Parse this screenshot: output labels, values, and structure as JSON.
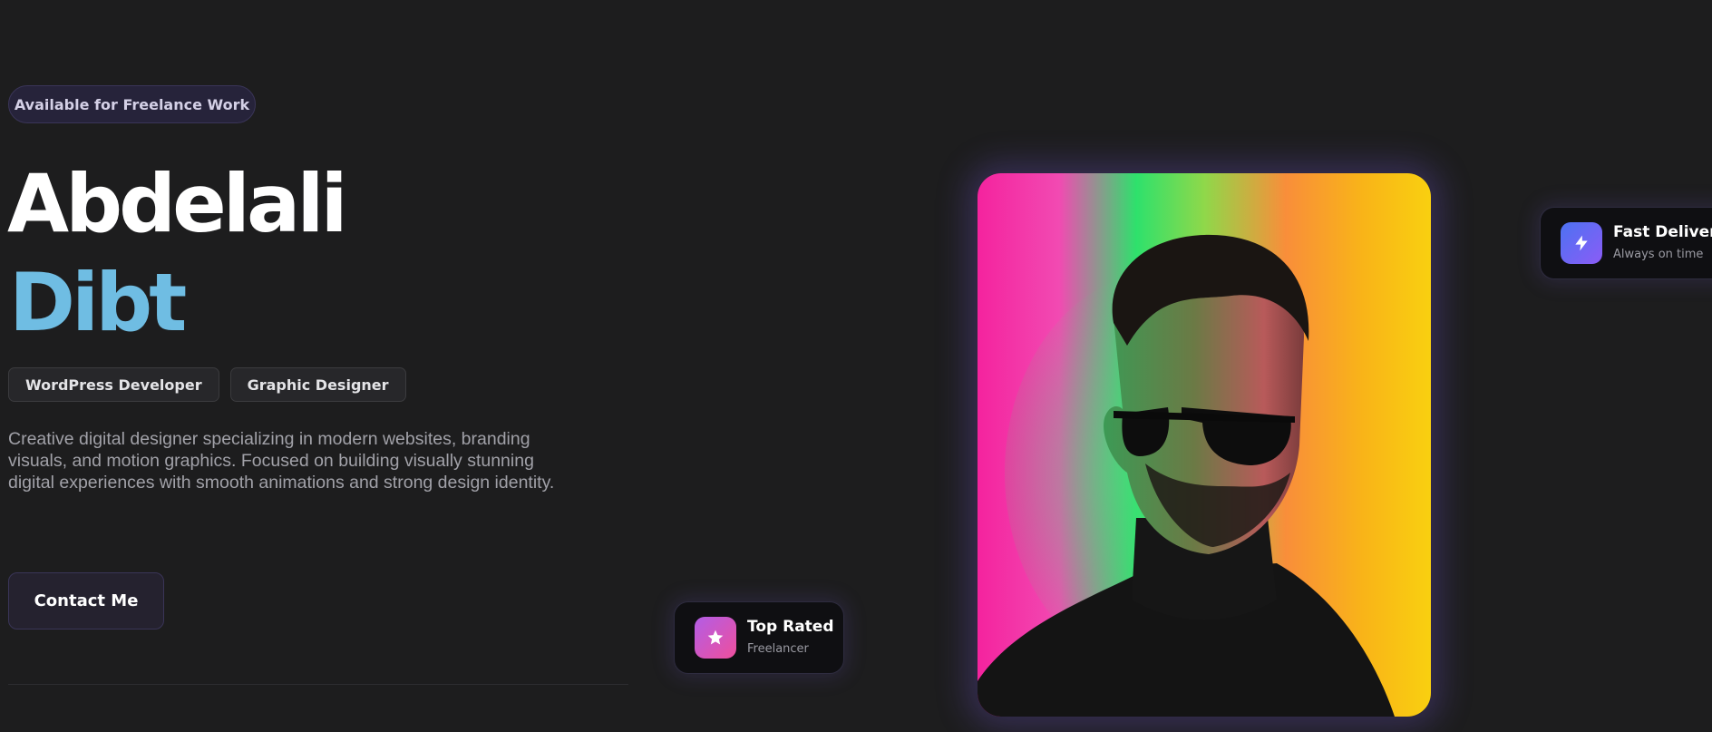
{
  "hero": {
    "badge": "Available for Freelance Work",
    "first_name": "Abdelali",
    "last_name": "Dibt",
    "tags": [
      "WordPress Developer",
      "Graphic Designer"
    ],
    "description": "Creative digital designer specializing in modern websites, branding visuals, and motion graphics. Focused on building visually stunning digital experiences with smooth animations and strong design identity.",
    "cta_label": "Contact Me"
  },
  "cards": {
    "top_rated": {
      "title": "Top Rated",
      "subtitle": "Freelancer",
      "icon": "star-icon"
    },
    "fast_delivery": {
      "title": "Fast Delivery",
      "subtitle": "Always on time",
      "icon": "lightning-icon"
    }
  },
  "colors": {
    "background": "#1d1d1e",
    "accent_name": "#6fbde3",
    "badge_bg": "#26233a",
    "star_gradient": [
      "#b25de6",
      "#ef4f9c"
    ],
    "lightning_gradient": [
      "#4c72f2",
      "#8b5cf6"
    ]
  }
}
